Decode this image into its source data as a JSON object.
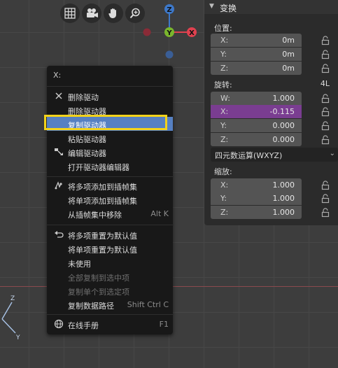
{
  "properties": {
    "header": "变换",
    "location": {
      "label": "位置:",
      "fields": [
        {
          "axis": "X:",
          "value": "0m"
        },
        {
          "axis": "Y:",
          "value": "0m"
        },
        {
          "axis": "Z:",
          "value": "0m"
        }
      ]
    },
    "rotation": {
      "label": "旋转:",
      "mode": "4L",
      "fields": [
        {
          "axis": "W:",
          "value": "1.000"
        },
        {
          "axis": "X:",
          "value": "-0.115"
        },
        {
          "axis": "Y:",
          "value": "0.000"
        },
        {
          "axis": "Z:",
          "value": "0.000"
        }
      ],
      "rotation_mode": "四元数运算(WXYZ)"
    },
    "scale": {
      "label": "缩放:",
      "fields": [
        {
          "axis": "X:",
          "value": "1.000"
        },
        {
          "axis": "Y:",
          "value": "1.000"
        },
        {
          "axis": "Z:",
          "value": "1.000"
        }
      ]
    }
  },
  "gizmo": {
    "z": "Z",
    "y": "Y",
    "x": "X"
  },
  "mini_axes": {
    "z": "Z",
    "y": "Y"
  },
  "menu": {
    "title": "X:",
    "items": [
      {
        "label": "删除驱动",
        "shortcut": ""
      },
      {
        "label": "删除驱动器",
        "shortcut": ""
      },
      {
        "label": "复制驱动器",
        "shortcut": ""
      },
      {
        "label": "粘贴驱动器",
        "shortcut": ""
      },
      {
        "label": "编辑驱动器",
        "shortcut": ""
      },
      {
        "label": "打开驱动器编辑器",
        "shortcut": ""
      },
      {
        "label": "将多项添加到插帧集",
        "shortcut": ""
      },
      {
        "label": "将单项添加到插帧集",
        "shortcut": ""
      },
      {
        "label": "从插帧集中移除",
        "shortcut": "Alt K"
      },
      {
        "label": "将多项重置为默认值",
        "shortcut": ""
      },
      {
        "label": "将单项重置为默认值",
        "shortcut": ""
      },
      {
        "label": "未使用",
        "shortcut": ""
      },
      {
        "label": "全部复制到选中项",
        "shortcut": ""
      },
      {
        "label": "复制单个到选定项",
        "shortcut": ""
      },
      {
        "label": "复制数据路径",
        "shortcut": "Shift Ctrl C"
      },
      {
        "label": "在线手册",
        "shortcut": "F1"
      }
    ]
  },
  "colors": {
    "accent": "#5680c2",
    "highlight_box": "#f2d21a",
    "x_axis": "#e0414f",
    "y_axis": "#7ab62d",
    "z_axis": "#3d78c9",
    "active_field": "#7a3d91"
  }
}
